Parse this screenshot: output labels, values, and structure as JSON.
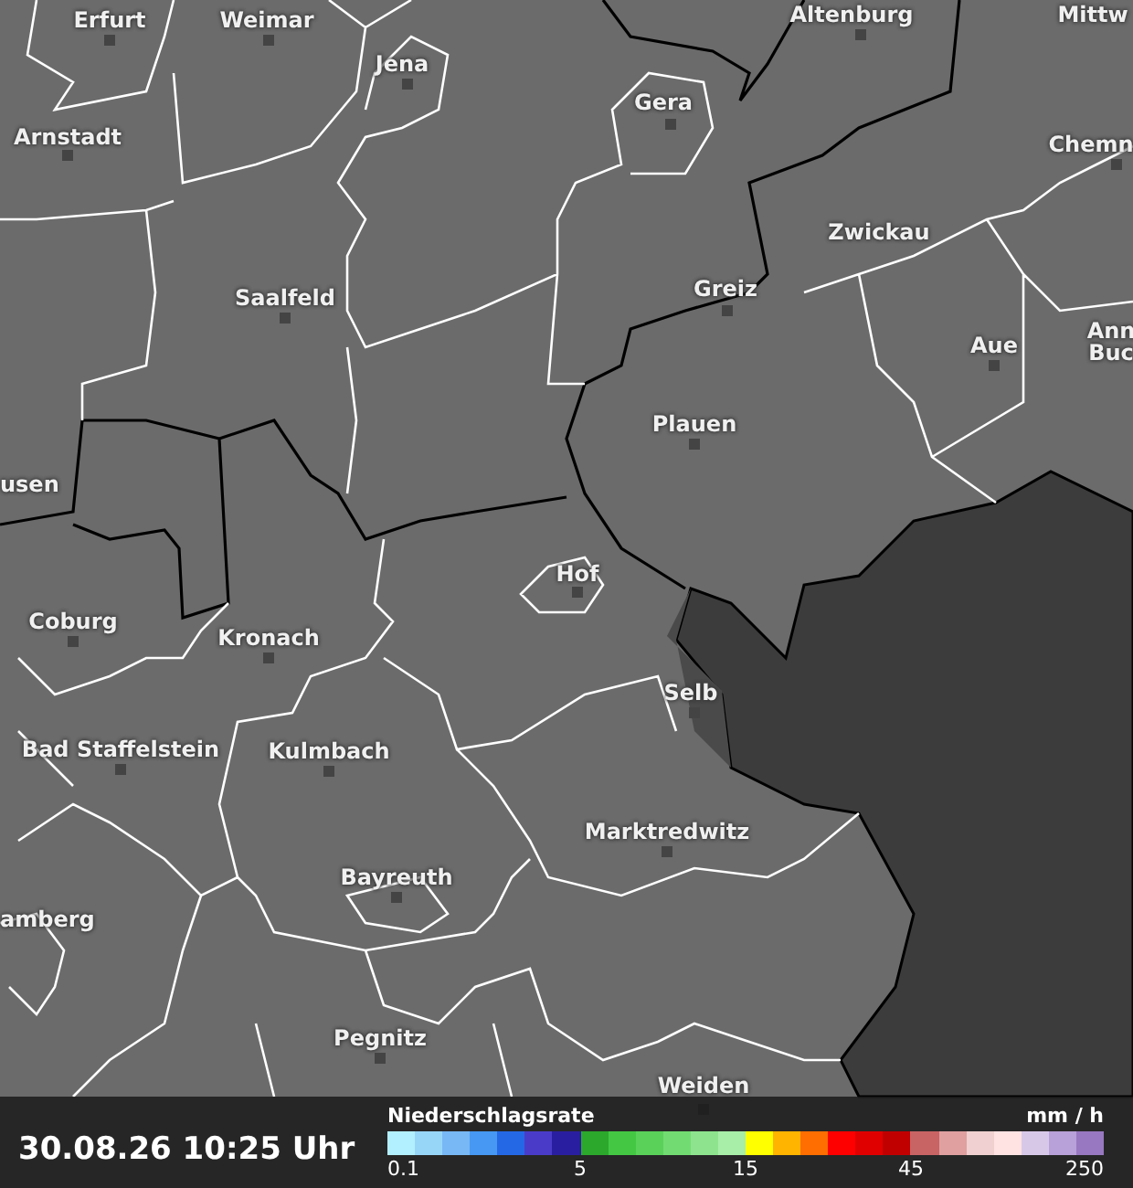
{
  "map": {
    "cities": [
      {
        "label": "Erfurt",
        "dot": true
      },
      {
        "label": "Weimar",
        "dot": true
      },
      {
        "label": "Jena",
        "dot": true
      },
      {
        "label": "Altenburg",
        "dot": true
      },
      {
        "label": "Mittw",
        "dot": false
      },
      {
        "label": "Arnstadt",
        "dot": true
      },
      {
        "label": "Gera",
        "dot": true
      },
      {
        "label": "Chemn",
        "dot": true
      },
      {
        "label": "Zwickau",
        "dot": false
      },
      {
        "label": "Saalfeld",
        "dot": true
      },
      {
        "label": "Greiz",
        "dot": true
      },
      {
        "label": "Ann",
        "dot": false
      },
      {
        "label": "Aue",
        "dot": true
      },
      {
        "label": "Buc",
        "dot": false
      },
      {
        "label": "Plauen",
        "dot": true
      },
      {
        "label": "usen",
        "dot": false
      },
      {
        "label": "Hof",
        "dot": true
      },
      {
        "label": "Coburg",
        "dot": true
      },
      {
        "label": "Kronach",
        "dot": true
      },
      {
        "label": "Selb",
        "dot": true
      },
      {
        "label": "Bad Staffelstein",
        "dot": true
      },
      {
        "label": "Kulmbach",
        "dot": true
      },
      {
        "label": "Marktredwitz",
        "dot": true
      },
      {
        "label": "Bayreuth",
        "dot": true
      },
      {
        "label": "amberg",
        "dot": false
      },
      {
        "label": "Pegnitz",
        "dot": true
      },
      {
        "label": "Weiden",
        "dot": true
      }
    ]
  },
  "status_bar": {
    "timestamp": "30.08.26 10:25 Uhr"
  },
  "legend": {
    "title": "Niederschlagsrate",
    "unit": "mm / h",
    "swatches": [
      {
        "color": "#b3f0ff"
      },
      {
        "color": "#98d6f8"
      },
      {
        "color": "#78b8f5"
      },
      {
        "color": "#4698f2"
      },
      {
        "color": "#2468e6"
      },
      {
        "color": "#4a3cc8"
      },
      {
        "color": "#2a1ea0"
      },
      {
        "color": "#2ca82c"
      },
      {
        "color": "#44c844"
      },
      {
        "color": "#5ad25a"
      },
      {
        "color": "#72dc72"
      },
      {
        "color": "#8ee48e"
      },
      {
        "color": "#a8eea8"
      },
      {
        "color": "#ffff00"
      },
      {
        "color": "#ffb400"
      },
      {
        "color": "#ff6e00"
      },
      {
        "color": "#ff0000"
      },
      {
        "color": "#e00000"
      },
      {
        "color": "#c00000"
      },
      {
        "color": "#c86464"
      },
      {
        "color": "#e0a0a0"
      },
      {
        "color": "#f0d0d0"
      },
      {
        "color": "#ffe2e2"
      },
      {
        "color": "#d8c8e8"
      },
      {
        "color": "#b8a0d8"
      },
      {
        "color": "#9878c0"
      }
    ],
    "ticks": [
      {
        "label": "0.1"
      },
      {
        "label": "5"
      },
      {
        "label": "15"
      },
      {
        "label": "45"
      },
      {
        "label": "250"
      }
    ]
  }
}
